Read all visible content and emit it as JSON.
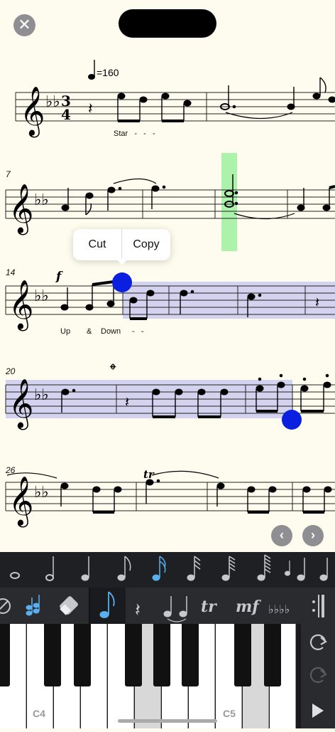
{
  "tempo": "=160",
  "measures": [
    "7",
    "14",
    "20",
    "26"
  ],
  "lyrics": {
    "line1": "Star   -   -   -",
    "line2a": "Up",
    "line2b": "&",
    "line2c": "Down",
    "line2d": "-   -"
  },
  "popup": {
    "cut": "Cut",
    "copy": "Copy"
  },
  "nav": {
    "prev": "‹",
    "next": "›"
  },
  "piano": {
    "c4": "C4",
    "c5": "C5"
  },
  "tools": {
    "trill": "tr",
    "dynamic": "mf"
  },
  "colors": {
    "selection": "#c8c8f0",
    "handle": "#0a1fe0",
    "highlight": "#9ef09e",
    "active_tool": "#5ab0ee"
  }
}
